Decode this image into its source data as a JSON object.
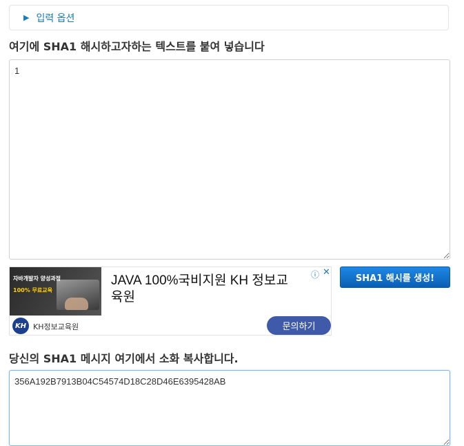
{
  "options": {
    "label": "입력 옵션",
    "icon": "triangle-right-icon"
  },
  "input_section": {
    "heading": "여기에 SHA1 해시하고자하는 텍스트를 붙여 넣습니다",
    "value": "1"
  },
  "ad": {
    "image_line1": "자바개발자 양성과정",
    "image_line2": "100% 무료교육",
    "headline": "JAVA 100%국비지원 KH 정보교육원",
    "logo_text": "KH",
    "org_name": "KH정보교육원",
    "cta_label": "문의하기",
    "info_icon": "info-icon",
    "close_icon": "close-icon"
  },
  "generate_button": {
    "label": "SHA1 해시를 생성!"
  },
  "output_section": {
    "heading": "당신의 SHA1 메시지 여기에서 소화 복사합니다.",
    "value": "356A192B7913B04C54574D18C28D46E6395428AB"
  }
}
